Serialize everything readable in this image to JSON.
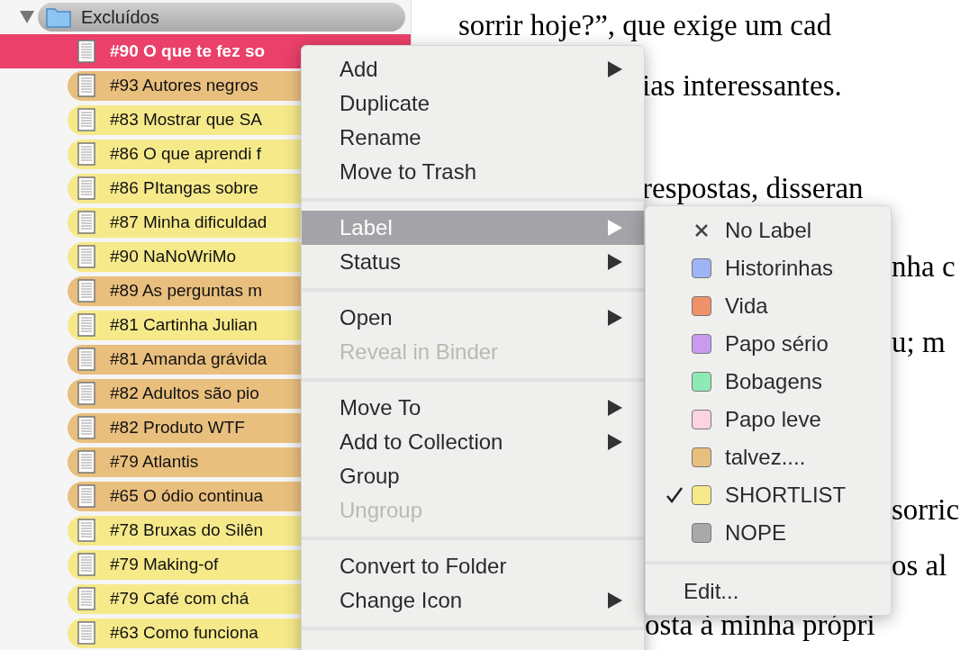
{
  "binder": {
    "folder": {
      "label": "Excluídos",
      "expanded": true
    },
    "items": [
      {
        "label": "#90 O que te fez so",
        "selected": true
      },
      {
        "label": "#93 Autores negros",
        "selected": false,
        "color": "#e9bf7e"
      },
      {
        "label": "#83 Mostrar que SA",
        "selected": false,
        "color": "#f6e98a"
      },
      {
        "label": "#86 O que aprendi f",
        "selected": false,
        "color": "#f6e98a"
      },
      {
        "label": "#86 PItangas sobre",
        "selected": false,
        "color": "#f6e98a"
      },
      {
        "label": "#87 Minha dificuldad",
        "selected": false,
        "color": "#f6e98a"
      },
      {
        "label": "#90 NaNoWriMo",
        "selected": false,
        "color": "#f6e98a"
      },
      {
        "label": "#89 As perguntas m",
        "selected": false,
        "color": "#e9bf7e"
      },
      {
        "label": "#81 Cartinha Julian",
        "selected": false,
        "color": "#f6e98a"
      },
      {
        "label": "#81 Amanda grávida",
        "selected": false,
        "color": "#e9bf7e"
      },
      {
        "label": "#82 Adultos são pio",
        "selected": false,
        "color": "#e9bf7e"
      },
      {
        "label": "#82 Produto WTF",
        "selected": false,
        "color": "#e9bf7e"
      },
      {
        "label": "#79 Atlantis",
        "selected": false,
        "color": "#e9bf7e"
      },
      {
        "label": "#65 O ódio continua",
        "selected": false,
        "color": "#e9bf7e"
      },
      {
        "label": "#78 Bruxas do Silên",
        "selected": false,
        "color": "#f6e98a"
      },
      {
        "label": "#79 Making-of",
        "selected": false,
        "color": "#f6e98a"
      },
      {
        "label": "#79 Café com chá",
        "selected": false,
        "color": "#f6e98a"
      },
      {
        "label": "#63 Como funciona",
        "selected": false,
        "color": "#f6e98a"
      }
    ]
  },
  "document": {
    "lines": [
      "sorrir hoje?”, que exige um cad",
      "ias interessantes.",
      "respostas, disseran",
      "nha c",
      "u; m",
      "sorric",
      "os al",
      "osta à minha própri"
    ]
  },
  "context_menu": {
    "items": [
      {
        "kind": "item",
        "label": "Add",
        "submenu": true,
        "disabled": false,
        "highlighted": false
      },
      {
        "kind": "item",
        "label": "Duplicate",
        "submenu": false,
        "disabled": false,
        "highlighted": false
      },
      {
        "kind": "item",
        "label": "Rename",
        "submenu": false,
        "disabled": false,
        "highlighted": false
      },
      {
        "kind": "item",
        "label": "Move to Trash",
        "submenu": false,
        "disabled": false,
        "highlighted": false
      },
      {
        "kind": "separator"
      },
      {
        "kind": "item",
        "label": "Label",
        "submenu": true,
        "disabled": false,
        "highlighted": true
      },
      {
        "kind": "item",
        "label": "Status",
        "submenu": true,
        "disabled": false,
        "highlighted": false
      },
      {
        "kind": "separator"
      },
      {
        "kind": "item",
        "label": "Open",
        "submenu": true,
        "disabled": false,
        "highlighted": false
      },
      {
        "kind": "item",
        "label": "Reveal in Binder",
        "submenu": false,
        "disabled": true,
        "highlighted": false
      },
      {
        "kind": "separator"
      },
      {
        "kind": "item",
        "label": "Move To",
        "submenu": true,
        "disabled": false,
        "highlighted": false
      },
      {
        "kind": "item",
        "label": "Add to Collection",
        "submenu": true,
        "disabled": false,
        "highlighted": false
      },
      {
        "kind": "item",
        "label": "Group",
        "submenu": false,
        "disabled": false,
        "highlighted": false
      },
      {
        "kind": "item",
        "label": "Ungroup",
        "submenu": false,
        "disabled": true,
        "highlighted": false
      },
      {
        "kind": "separator"
      },
      {
        "kind": "item",
        "label": "Convert to Folder",
        "submenu": false,
        "disabled": false,
        "highlighted": false
      },
      {
        "kind": "item",
        "label": "Change Icon",
        "submenu": true,
        "disabled": false,
        "highlighted": false
      },
      {
        "kind": "separator"
      }
    ]
  },
  "label_submenu": {
    "items": [
      {
        "kind": "none",
        "label": "No Label",
        "checked": false
      },
      {
        "kind": "color",
        "label": "Historinhas",
        "color": "#9fb4f5",
        "checked": false
      },
      {
        "kind": "color",
        "label": "Vida",
        "color": "#f0916a",
        "checked": false
      },
      {
        "kind": "color",
        "label": "Papo sério",
        "color": "#c99bf0",
        "checked": false
      },
      {
        "kind": "color",
        "label": "Bobagens",
        "color": "#8eeab5",
        "checked": false
      },
      {
        "kind": "color",
        "label": "Papo leve",
        "color": "#fbd3e3",
        "checked": false
      },
      {
        "kind": "color",
        "label": "talvez....",
        "color": "#e9bf7e",
        "checked": false
      },
      {
        "kind": "color",
        "label": "SHORTLIST",
        "color": "#f6e98a",
        "checked": true
      },
      {
        "kind": "color",
        "label": "NOPE",
        "color": "#a9a9a9",
        "checked": false
      }
    ],
    "footer": "Edit..."
  }
}
